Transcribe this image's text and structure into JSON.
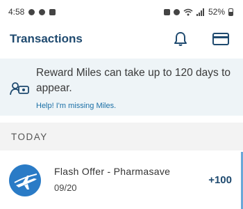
{
  "status_bar": {
    "time": "4:58",
    "battery": "52%"
  },
  "header": {
    "title": "Transactions",
    "icons": [
      "bell-icon",
      "card-icon"
    ]
  },
  "banner": {
    "message": "Reward Miles can take up to 120 days to appear.",
    "link_label": "Help! I'm missing Miles."
  },
  "section": {
    "label": "TODAY"
  },
  "transactions": [
    {
      "name": "Flash Offer - Pharmasave",
      "date": "09/20",
      "amount": "+100"
    }
  ],
  "colors": {
    "brand": "#1f4a6f",
    "link": "#1a6fa6",
    "banner_bg": "#eef4f7",
    "section_bg": "#f3f3f3",
    "plane_badge": "#2a7bc6"
  }
}
